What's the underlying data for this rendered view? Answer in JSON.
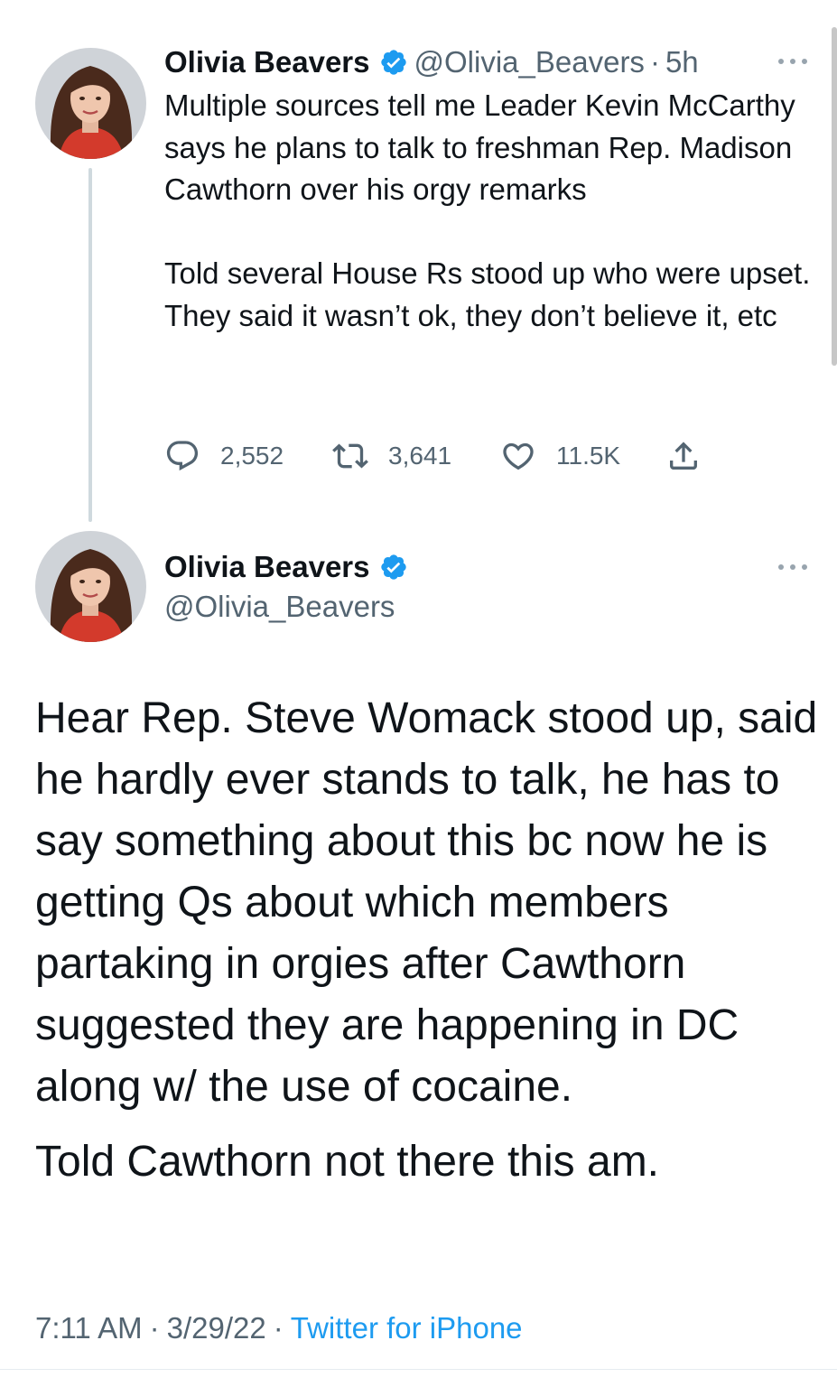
{
  "colors": {
    "text": "#0f1419",
    "secondary": "#536471",
    "link": "#1d9bf0",
    "verified": "#1d9bf0",
    "thread_line": "#cfd9de"
  },
  "parent_tweet": {
    "author_name": "Olivia Beavers",
    "handle": "@Olivia_Beavers",
    "separator": "·",
    "time_ago": "5h",
    "paragraphs": [
      "Multiple sources tell me Leader Kevin McCarthy says he plans to talk to freshman Rep. Madison Cawthorn over his orgy remarks",
      "Told several House Rs stood up who were upset. They said it wasn’t ok, they don’t believe it, etc"
    ],
    "actions": {
      "reply_count": "2,552",
      "retweet_count": "3,641",
      "like_count": "11.5K"
    },
    "icons": [
      "verified-badge-icon",
      "more-icon",
      "reply-icon",
      "retweet-icon",
      "like-icon",
      "share-icon"
    ]
  },
  "main_tweet": {
    "author_name": "Olivia Beavers",
    "handle": "@Olivia_Beavers",
    "paragraphs": [
      "Hear Rep. Steve Womack stood up, said he hardly ever stands to talk, he has to say something about this bc now he is getting Qs about which members partaking in orgies after Cawthorn suggested they are happening in DC along w/ the use of cocaine.",
      "Told Cawthorn not there this am."
    ],
    "time": "7:11 AM",
    "date": "3/29/22",
    "meta_separator": "·",
    "source": "Twitter for iPhone"
  }
}
